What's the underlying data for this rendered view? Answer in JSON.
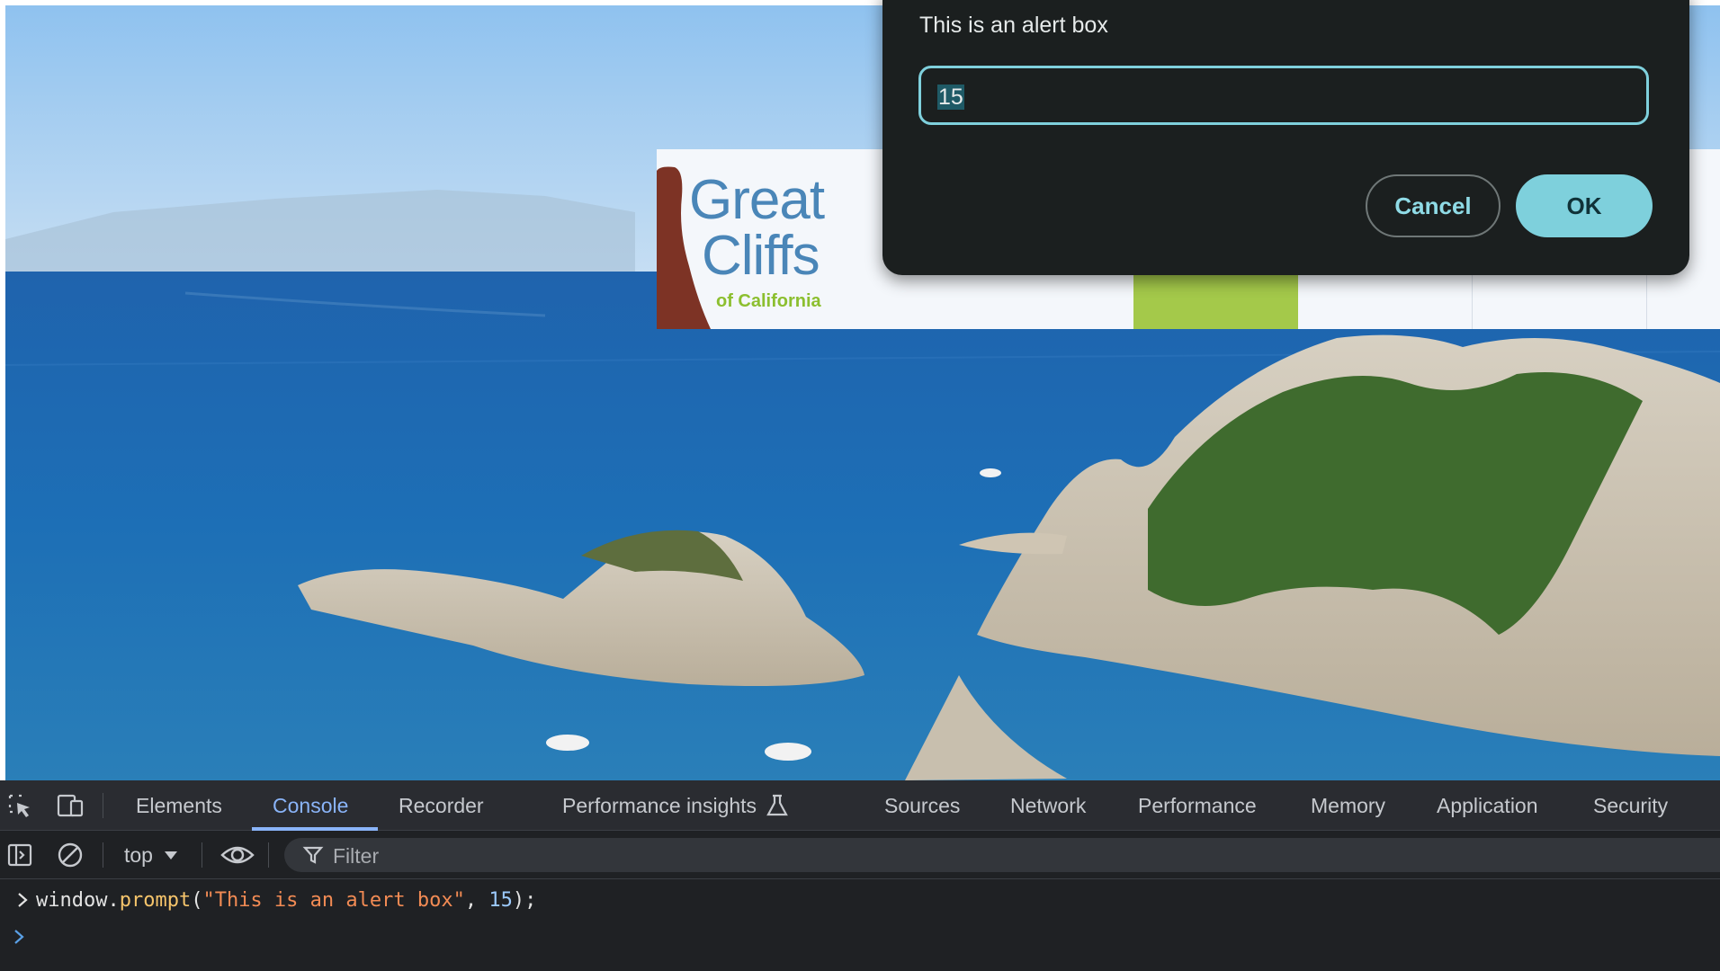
{
  "site": {
    "logo": {
      "line1": "Great",
      "line2": "Cliffs",
      "line3": "of California"
    }
  },
  "dialog": {
    "message": "This is an alert box",
    "input_value": "15",
    "cancel_label": "Cancel",
    "ok_label": "OK",
    "accent_color": "#7ed0dc"
  },
  "devtools": {
    "tabs": [
      {
        "label": "Elements"
      },
      {
        "label": "Console",
        "active": true
      },
      {
        "label": "Recorder"
      },
      {
        "label": "Performance insights"
      },
      {
        "label": "Sources"
      },
      {
        "label": "Network"
      },
      {
        "label": "Performance"
      },
      {
        "label": "Memory"
      },
      {
        "label": "Application"
      },
      {
        "label": "Security"
      }
    ],
    "toolbar": {
      "context": "top",
      "filter_placeholder": "Filter"
    },
    "console": {
      "command": {
        "object": "window.",
        "method": "prompt",
        "open": "(",
        "string_arg": "\"This is an alert box\"",
        "comma": ", ",
        "number_arg": "15",
        "close": ");"
      },
      "prompt_symbol": ">"
    },
    "icons": [
      "inspect-element-icon",
      "device-toolbar-icon",
      "flask-icon",
      "sidebar-icon",
      "clear-console-icon",
      "dropdown-triangle-icon",
      "eye-icon",
      "filter-icon",
      "chevron-right-icon"
    ]
  }
}
